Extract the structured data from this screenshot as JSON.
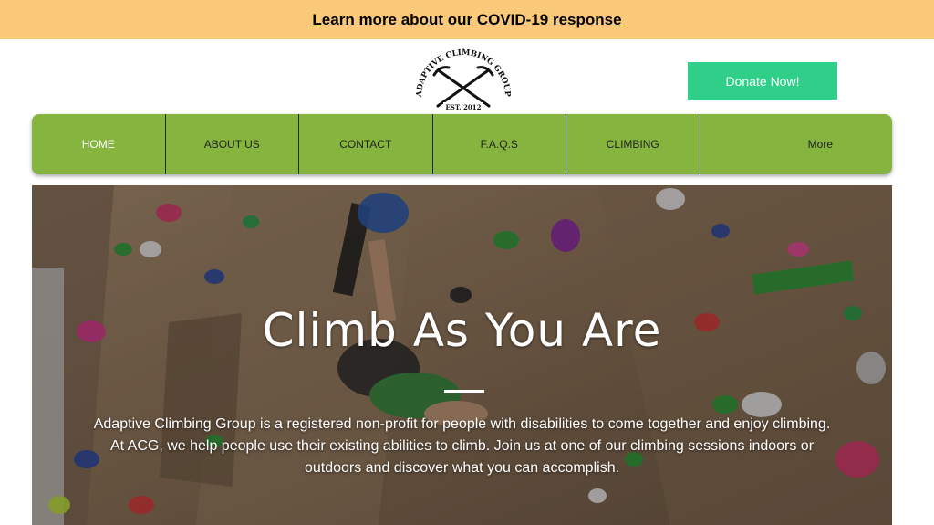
{
  "banner": {
    "link_text": "Learn more about our COVID-19 response"
  },
  "logo": {
    "arc_text": "ADAPTIVE CLIMBING GROUP",
    "established": "EST. 2012",
    "icon": "crossed-ice-axes"
  },
  "donate": {
    "label": "Donate Now!"
  },
  "nav": {
    "items": [
      {
        "label": "HOME",
        "active": true
      },
      {
        "label": "ABOUT US"
      },
      {
        "label": "CONTACT"
      },
      {
        "label": "F.A.Q.S"
      },
      {
        "label": "CLIMBING"
      },
      {
        "label": "More"
      }
    ]
  },
  "hero": {
    "title": "Climb As You Are",
    "description": "Adaptive Climbing Group is a registered non-profit for people with disabilities to come together and enjoy climbing. At ACG, we help people use their existing abilities to climb. Join us at one of our climbing sessions indoors or outdoors and discover what you can accomplish."
  },
  "colors": {
    "banner": "#fbc97a",
    "donate": "#2fcf8a",
    "nav": "#85b53f"
  }
}
